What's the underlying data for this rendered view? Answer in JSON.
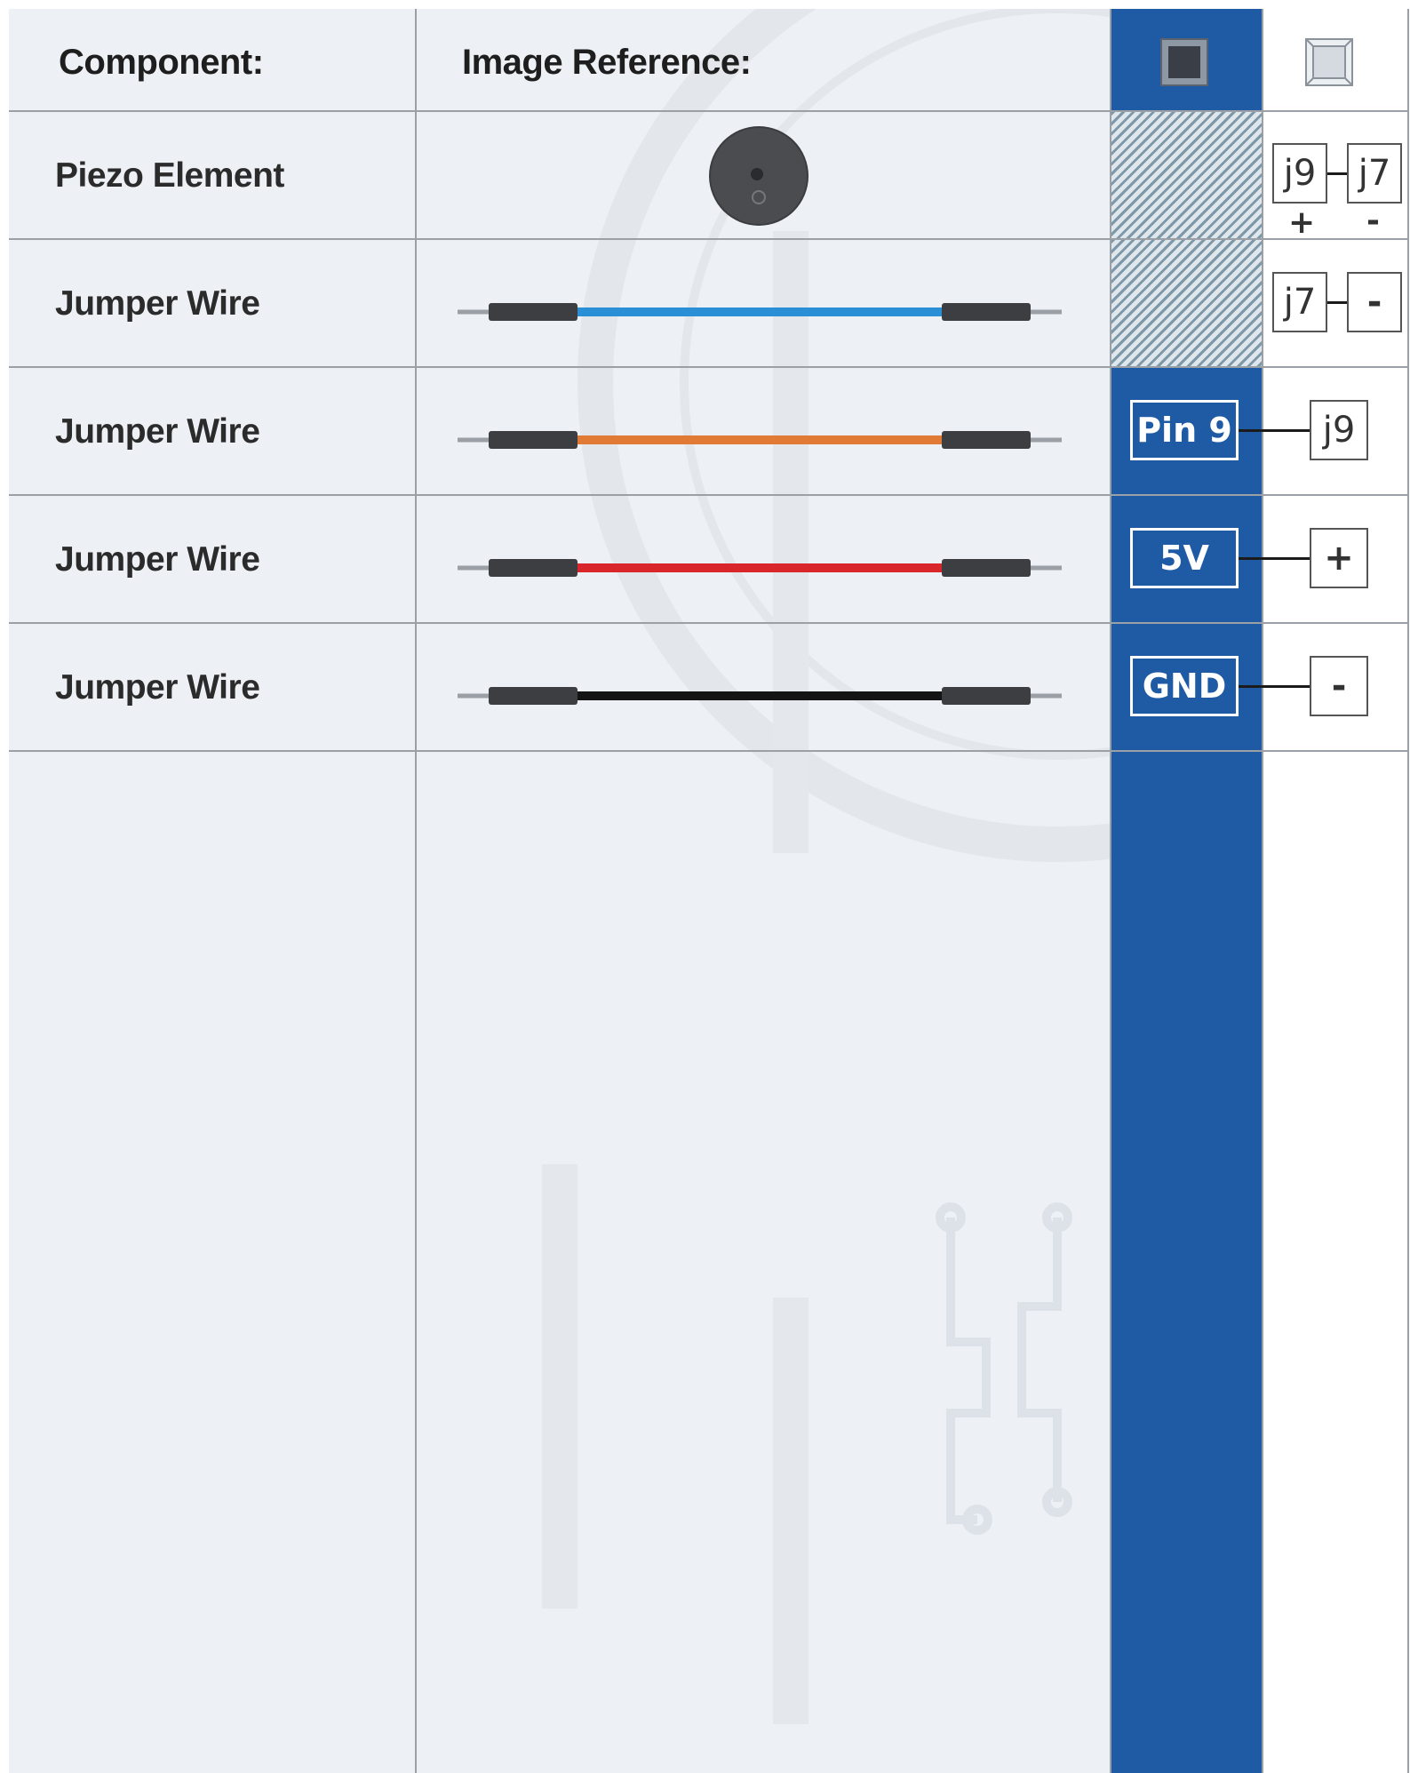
{
  "header": {
    "component_label": "Component:",
    "image_reference_label": "Image Reference:",
    "arduino_column_icon": "chip-dark-icon",
    "breadboard_column_icon": "chip-light-icon"
  },
  "colors": {
    "arduino_column": "#1f5aa5",
    "grid_line": "#9aa0a6",
    "row_background": "#edf0f4"
  },
  "rows": [
    {
      "component": "Piezo Element",
      "image": "piezo-buzzer",
      "arduino": null,
      "breadboard": [
        "j9",
        "j7"
      ],
      "polarity": [
        "+",
        "-"
      ]
    },
    {
      "component": "Jumper Wire",
      "image": "jumper-wire",
      "wire_color": "#2b8fd8",
      "arduino": null,
      "breadboard": [
        "j7",
        "-"
      ]
    },
    {
      "component": "Jumper Wire",
      "image": "jumper-wire",
      "wire_color": "#e07a35",
      "arduino": "Pin 9",
      "breadboard": [
        "j9"
      ]
    },
    {
      "component": "Jumper Wire",
      "image": "jumper-wire",
      "wire_color": "#d8262a",
      "arduino": "5V",
      "breadboard": [
        "+"
      ]
    },
    {
      "component": "Jumper Wire",
      "image": "jumper-wire",
      "wire_color": "#141414",
      "arduino": "GND",
      "breadboard": [
        "-"
      ]
    }
  ]
}
